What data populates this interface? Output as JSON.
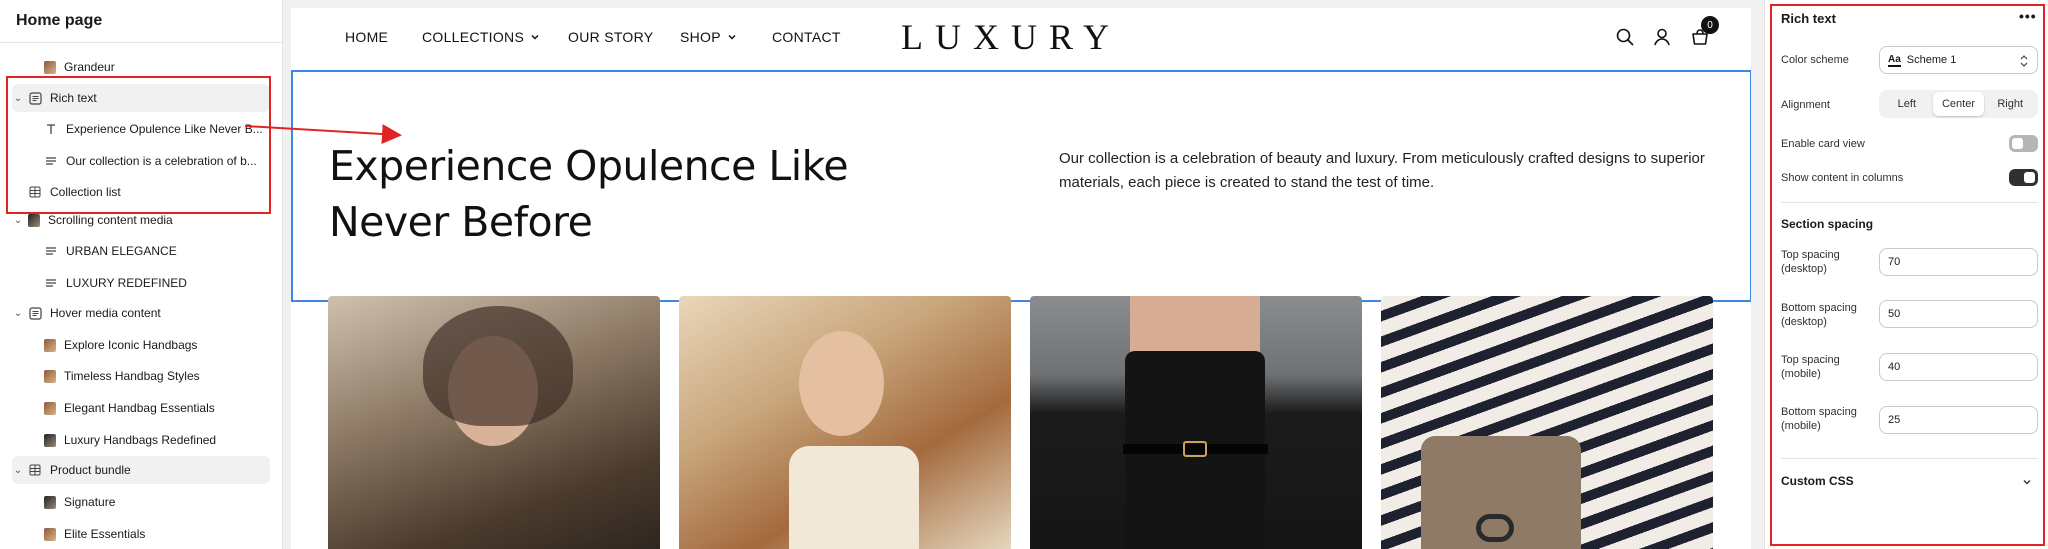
{
  "sidebar": {
    "title": "Home page",
    "items": [
      {
        "label": "Grandeur",
        "kind": "thumb",
        "depth": 2,
        "icon": "image-thumbnail-icon"
      },
      {
        "label": "Rich text",
        "kind": "section",
        "depth": 1,
        "icon": "rich-text-section-icon",
        "expanded": true
      },
      {
        "label": "Experience Opulence Like Never B...",
        "kind": "block",
        "depth": 2,
        "icon": "heading-icon"
      },
      {
        "label": "Our collection is a celebration of b...",
        "kind": "block",
        "depth": 2,
        "icon": "text-lines-icon"
      },
      {
        "label": "Collection list",
        "kind": "section",
        "depth": 1,
        "icon": "grid-icon"
      },
      {
        "label": "Scrolling content media",
        "kind": "section",
        "depth": 1,
        "icon": "image-thumbnail-icon",
        "expanded": true
      },
      {
        "label": "URBAN ELEGANCE",
        "kind": "block",
        "depth": 2,
        "icon": "text-lines-icon"
      },
      {
        "label": "LUXURY REDEFINED",
        "kind": "block",
        "depth": 2,
        "icon": "text-lines-icon"
      },
      {
        "label": "Hover media content",
        "kind": "section",
        "depth": 1,
        "icon": "rich-text-section-icon",
        "expanded": true
      },
      {
        "label": "Explore Iconic Handbags",
        "kind": "thumb",
        "depth": 2,
        "icon": "image-thumbnail-icon"
      },
      {
        "label": "Timeless Handbag Styles",
        "kind": "thumb",
        "depth": 2,
        "icon": "image-thumbnail-icon"
      },
      {
        "label": "Elegant Handbag Essentials",
        "kind": "thumb",
        "depth": 2,
        "icon": "image-thumbnail-icon"
      },
      {
        "label": "Luxury Handbags Redefined",
        "kind": "thumb",
        "depth": 2,
        "icon": "image-thumbnail-icon"
      },
      {
        "label": "Product bundle",
        "kind": "section",
        "depth": 1,
        "icon": "grid-icon",
        "expanded": true
      },
      {
        "label": "Signature",
        "kind": "thumb",
        "depth": 2,
        "icon": "image-thumbnail-icon"
      },
      {
        "label": "Elite Essentials",
        "kind": "thumb",
        "depth": 2,
        "icon": "image-thumbnail-icon"
      }
    ]
  },
  "store": {
    "nav": {
      "home": "HOME",
      "collections": "COLLECTIONS",
      "our_story": "OUR STORY",
      "shop": "SHOP",
      "contact": "CONTACT"
    },
    "logo": "LUXURY",
    "cart_count": "0",
    "rich_text": {
      "heading": "Experience Opulence Like Never Before",
      "body": "Our collection is a celebration of beauty and luxury. From meticulously crafted designs to superior materials, each piece is created to stand the test of time."
    }
  },
  "settings": {
    "title": "Rich text",
    "more": "•••",
    "color_scheme_label": "Color scheme",
    "color_scheme_value": "Scheme 1",
    "color_scheme_badge": "Aa",
    "alignment_label": "Alignment",
    "alignment_options": [
      "Left",
      "Center",
      "Right"
    ],
    "alignment_selected": "Center",
    "enable_card_view_label": "Enable card view",
    "enable_card_view": false,
    "show_columns_label": "Show content in columns",
    "show_columns": true,
    "section_spacing_title": "Section spacing",
    "top_desktop_label": "Top spacing (desktop)",
    "top_desktop": "70",
    "bottom_desktop_label": "Bottom spacing (desktop)",
    "bottom_desktop": "50",
    "top_mobile_label": "Top spacing (mobile)",
    "top_mobile": "40",
    "bottom_mobile_label": "Bottom spacing (mobile)",
    "bottom_mobile": "25",
    "custom_css_label": "Custom CSS"
  },
  "colors": {
    "selection_blue": "#3d87e6",
    "annotation_red": "#e02424",
    "toggle_on": "#303030",
    "toggle_off": "#b5b5b5"
  }
}
